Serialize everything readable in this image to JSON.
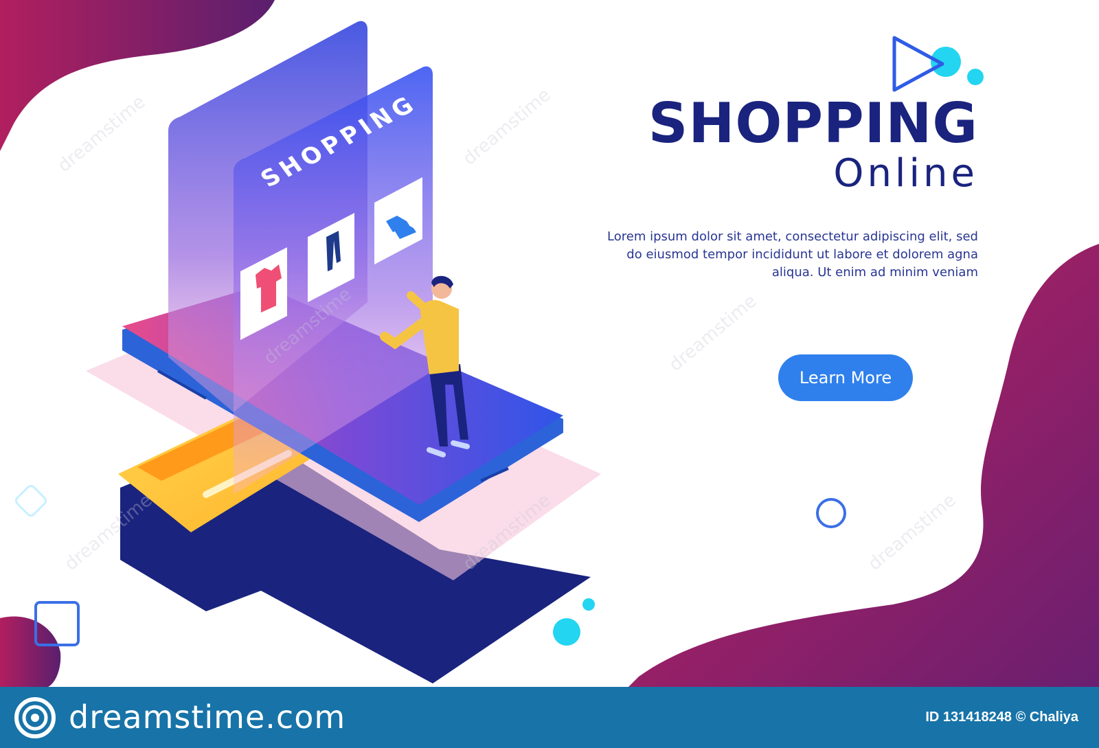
{
  "hero": {
    "title": "SHOPPING",
    "subtitle": "Online",
    "body": "Lorem ipsum dolor sit amet, consectetur adipiscing elit, sed do eiusmod tempor incididunt ut labore et dolorem agna aliqua. Ut enim ad minim veniam",
    "cta_label": "Learn More"
  },
  "phone_screen": {
    "label": "SHOPPING",
    "products": [
      "tshirt-icon",
      "jeans-icon",
      "shoes-icon"
    ]
  },
  "watermark": {
    "text": "dreamstime"
  },
  "footer": {
    "brand": "dreamstime.com",
    "image_id": "ID 131418248 © Chaliya"
  },
  "icons": {
    "play": "play-icon",
    "credit_card": "credit-card-icon",
    "logo": "dreamstime-logo-icon"
  },
  "colors": {
    "primary_text": "#1a237e",
    "accent_blue": "#2f80ed",
    "blob_start": "#b11f5f",
    "blob_end": "#5a1f6e",
    "footer_bg": "#1773a8",
    "cyan": "#23d5f0"
  }
}
